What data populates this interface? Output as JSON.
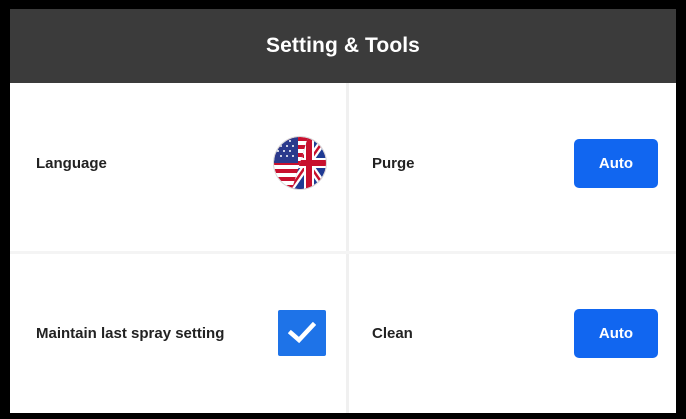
{
  "header": {
    "title": "Setting & Tools"
  },
  "settings": {
    "language": {
      "label": "Language",
      "icon": "us-uk-flag-icon"
    },
    "purge": {
      "label": "Purge",
      "button_label": "Auto"
    },
    "maintain": {
      "label": "Maintain last spray setting",
      "checked": true,
      "icon": "checkmark-icon"
    },
    "clean": {
      "label": "Clean",
      "button_label": "Auto"
    }
  },
  "colors": {
    "header_bg": "#3b3b3b",
    "accent": "#1166f0",
    "checkbox": "#1e73e8",
    "frame": "#000000"
  }
}
